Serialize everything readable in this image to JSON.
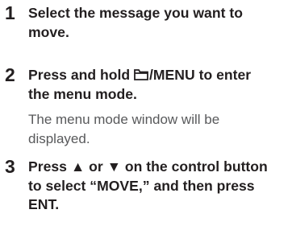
{
  "steps": [
    {
      "number": "1",
      "lines": [
        "Select the message you want to",
        "move."
      ]
    },
    {
      "number": "2",
      "line1_before": "Press and hold ",
      "icon": "folder-icon",
      "line1_after": "/MENU to enter",
      "line2": "the menu mode.",
      "note_lines": [
        "The menu mode window will be",
        "displayed."
      ]
    },
    {
      "number": "3",
      "lines": [
        "Press ▲ or ▼ on the control button",
        "to select “MOVE,” and then press",
        "ENT."
      ]
    }
  ]
}
